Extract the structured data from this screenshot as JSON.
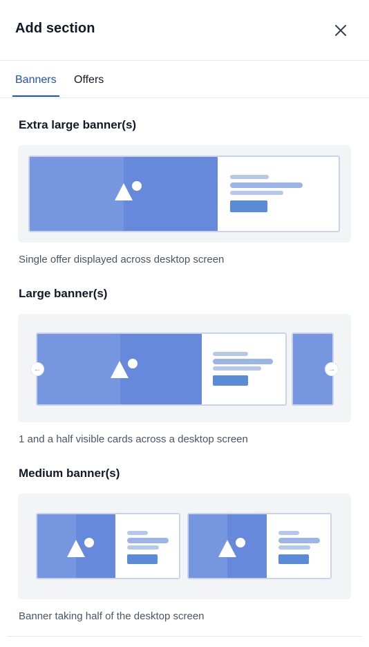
{
  "header": {
    "title": "Add section",
    "close_icon": "close-icon"
  },
  "tabs": [
    {
      "label": "Banners",
      "active": true
    },
    {
      "label": "Offers",
      "active": false
    }
  ],
  "sections": [
    {
      "title": "Extra large banner(s)",
      "description": "Single offer displayed across desktop screen"
    },
    {
      "title": "Large banner(s)",
      "description": "1 and a half visible cards across a desktop screen"
    },
    {
      "title": "Medium banner(s)",
      "description": "Banner taking half of the desktop screen"
    }
  ],
  "icons": {
    "image_placeholder": "image-placeholder-icon",
    "prev": "chevron-left-icon",
    "next": "chevron-right-icon"
  },
  "colors": {
    "accent": "#1f4fbf",
    "preview_bg": "#f3f4f6",
    "image_light": "#7697e0",
    "image_dark": "#6689dc",
    "button_shape": "#5a8bd6"
  }
}
